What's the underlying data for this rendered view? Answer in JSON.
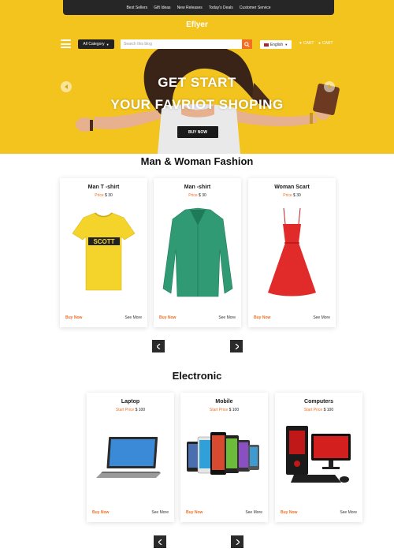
{
  "topnav": [
    "Best Sellers",
    "Gift Ideas",
    "New Releases",
    "Today's Deals",
    "Customer Service"
  ],
  "logo": "Eflyer",
  "toolbar": {
    "category_label": "All Category",
    "search_placeholder": "Search this blog",
    "language": "English",
    "cart_label_1": "CART",
    "cart_label_2": "CART"
  },
  "hero": {
    "line1": "GET START",
    "line2": "YOUR FAVRIOT SHOPING",
    "button": "BUY NOW"
  },
  "fashion": {
    "title": "Man & Woman Fashion",
    "products": [
      {
        "name": "Man T -shirt",
        "price_label": "Price",
        "price": "$ 30"
      },
      {
        "name": "Man -shirt",
        "price_label": "Price",
        "price": "$ 30"
      },
      {
        "name": "Woman Scart",
        "price_label": "Price",
        "price": "$ 30"
      }
    ]
  },
  "electronic": {
    "title": "Electronic",
    "products": [
      {
        "name": "Laptop",
        "price_label": "Start Price",
        "price": "$ 100"
      },
      {
        "name": "Mobile",
        "price_label": "Start Price",
        "price": "$ 100"
      },
      {
        "name": "Computers",
        "price_label": "Start Price",
        "price": "$ 100"
      }
    ]
  },
  "card_actions": {
    "buy": "Buy Now",
    "more": "See More"
  },
  "colors": {
    "hero_yellow": "#f3c41e",
    "accent_orange": "#f26e22",
    "dark": "#262626"
  }
}
